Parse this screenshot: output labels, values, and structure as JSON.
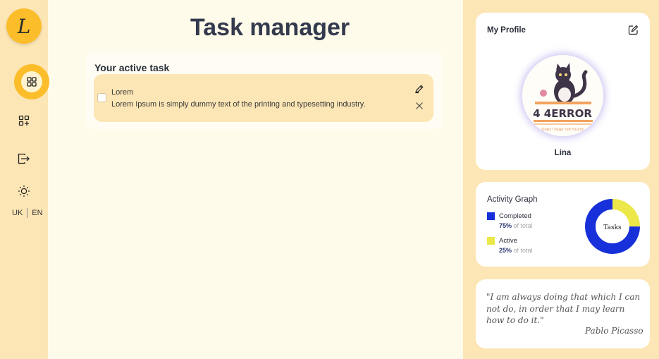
{
  "sidebar": {
    "logo_letter": "L",
    "nav": [
      {
        "icon": "grid-icon"
      },
      {
        "icon": "add-grid-icon"
      },
      {
        "icon": "logout-icon"
      },
      {
        "icon": "sun-icon"
      }
    ],
    "lang": {
      "uk": "UK",
      "en": "EN"
    }
  },
  "main": {
    "title": "Task manager",
    "panel_title": "Your active task",
    "tasks": [
      {
        "title": "Lorem",
        "description": "Lorem Ipsum is simply dummy text of the printing and typesetting industry."
      }
    ]
  },
  "profile": {
    "title": "My Profile",
    "name": "Lina",
    "avatar_text": "4 4ERROR",
    "avatar_subtext": "Oops! Page not found"
  },
  "activity": {
    "title": "Activity Graph",
    "center_label": "Tasks",
    "of_total": "of total",
    "items": [
      {
        "label": "Completed",
        "percent": "75%",
        "color": "#1730d9",
        "value": 75
      },
      {
        "label": "Active",
        "percent": "25%",
        "color": "#ece84a",
        "value": 25
      }
    ]
  },
  "quote": {
    "line1": "\"I am always doing that which I can",
    "line2": "not do, in order that I may learn",
    "line3": "how to do it.\"",
    "author": "Pablo Picasso"
  },
  "colors": {
    "accent": "#fbbd2a",
    "sidebar_bg": "#fde6b5",
    "main_bg": "#fffbea",
    "title_text": "#333a4d"
  }
}
